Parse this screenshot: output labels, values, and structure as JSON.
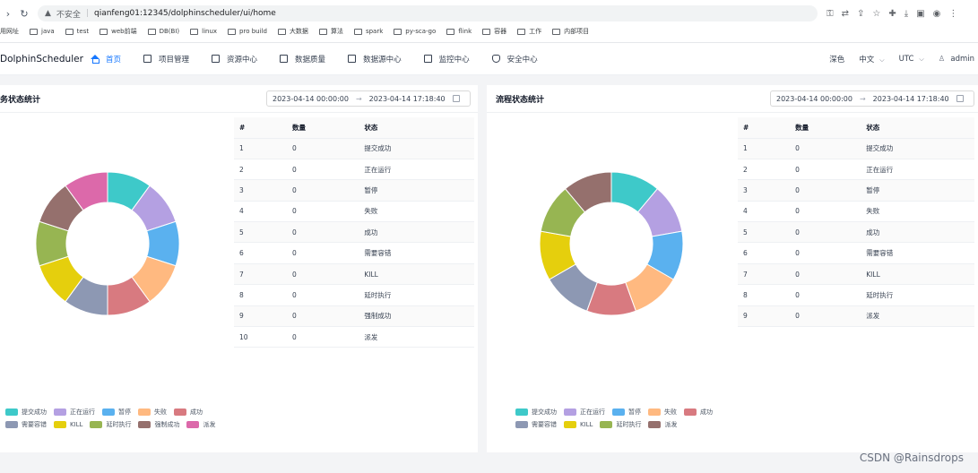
{
  "browser": {
    "insecure": "不安全",
    "url": "qianfeng01:12345/dolphinscheduler/ui/home",
    "bookmarks": [
      "用网址",
      "java",
      "test",
      "web前端",
      "DB(BI)",
      "linux",
      "pro build",
      "大数据",
      "算法",
      "spark",
      "py-sca-go",
      "flink",
      "容器",
      "工作",
      "内部项目"
    ]
  },
  "app": {
    "logo": "DolphinScheduler",
    "menu": [
      {
        "label": "首页",
        "icon": "home-icon",
        "active": true
      },
      {
        "label": "项目管理",
        "icon": "project-icon"
      },
      {
        "label": "资源中心",
        "icon": "folder-icon"
      },
      {
        "label": "数据质量",
        "icon": "quality-icon"
      },
      {
        "label": "数据源中心",
        "icon": "datasource-icon"
      },
      {
        "label": "监控中心",
        "icon": "monitor-icon"
      },
      {
        "label": "安全中心",
        "icon": "shield-icon"
      }
    ],
    "theme": "深色",
    "language": "中文",
    "timezone": "UTC",
    "user": "admin"
  },
  "left_panel": {
    "title": "务状态统计",
    "date_start": "2023-04-14 00:00:00",
    "date_end": "2023-04-14 17:18:40",
    "headers": [
      "#",
      "数量",
      "状态"
    ],
    "rows": [
      [
        "1",
        "0",
        "提交成功"
      ],
      [
        "2",
        "0",
        "正在运行"
      ],
      [
        "3",
        "0",
        "暂停"
      ],
      [
        "4",
        "0",
        "失败"
      ],
      [
        "5",
        "0",
        "成功"
      ],
      [
        "6",
        "0",
        "需要容错"
      ],
      [
        "7",
        "0",
        "KILL"
      ],
      [
        "8",
        "0",
        "延时执行"
      ],
      [
        "9",
        "0",
        "强制成功"
      ],
      [
        "10",
        "0",
        "派发"
      ]
    ],
    "legend": [
      {
        "label": "提交成功",
        "color": "#3ec9c9"
      },
      {
        "label": "正在运行",
        "color": "#b4a0e2"
      },
      {
        "label": "暂停",
        "color": "#5ab1ef"
      },
      {
        "label": "失败",
        "color": "#ffb980"
      },
      {
        "label": "成功",
        "color": "#d87a80"
      },
      {
        "label": "需要容错",
        "color": "#8d98b3"
      },
      {
        "label": "KILL",
        "color": "#e5cf0d"
      },
      {
        "label": "延时执行",
        "color": "#97b552"
      },
      {
        "label": "强制成功",
        "color": "#95706d"
      },
      {
        "label": "派发",
        "color": "#dc69aa"
      }
    ]
  },
  "right_panel": {
    "title": "流程状态统计",
    "date_start": "2023-04-14 00:00:00",
    "date_end": "2023-04-14 17:18:40",
    "headers": [
      "#",
      "数量",
      "状态"
    ],
    "rows": [
      [
        "1",
        "0",
        "提交成功"
      ],
      [
        "2",
        "0",
        "正在运行"
      ],
      [
        "3",
        "0",
        "暂停"
      ],
      [
        "4",
        "0",
        "失败"
      ],
      [
        "5",
        "0",
        "成功"
      ],
      [
        "6",
        "0",
        "需要容错"
      ],
      [
        "7",
        "0",
        "KILL"
      ],
      [
        "8",
        "0",
        "延时执行"
      ],
      [
        "9",
        "0",
        "派发"
      ]
    ],
    "legend": [
      {
        "label": "提交成功",
        "color": "#3ec9c9"
      },
      {
        "label": "正在运行",
        "color": "#b4a0e2"
      },
      {
        "label": "暂停",
        "color": "#5ab1ef"
      },
      {
        "label": "失败",
        "color": "#ffb980"
      },
      {
        "label": "成功",
        "color": "#d87a80"
      },
      {
        "label": "需要容错",
        "color": "#8d98b3"
      },
      {
        "label": "KILL",
        "color": "#e5cf0d"
      },
      {
        "label": "延时执行",
        "color": "#97b552"
      },
      {
        "label": "派发",
        "color": "#95706d"
      }
    ]
  },
  "watermark": "CSDN @Rainsdrops"
}
